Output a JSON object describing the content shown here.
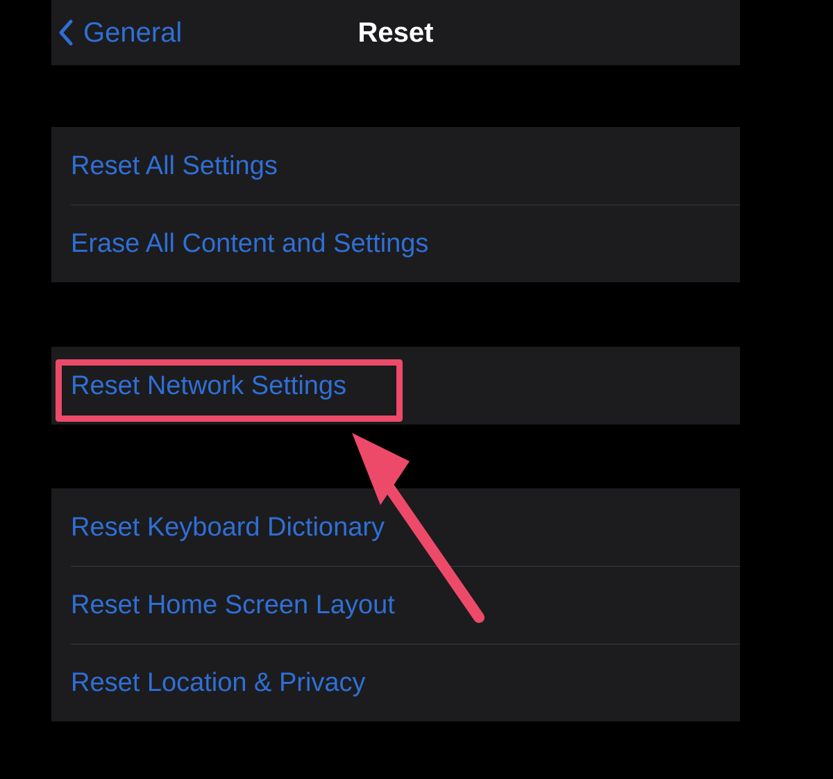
{
  "nav": {
    "back_label": "General",
    "title": "Reset"
  },
  "groups": {
    "g1": {
      "items": [
        {
          "label": "Reset All Settings"
        },
        {
          "label": "Erase All Content and Settings"
        }
      ]
    },
    "g2": {
      "items": [
        {
          "label": "Reset Network Settings"
        }
      ]
    },
    "g3": {
      "items": [
        {
          "label": "Reset Keyboard Dictionary"
        },
        {
          "label": "Reset Home Screen Layout"
        },
        {
          "label": "Reset Location & Privacy"
        }
      ]
    }
  },
  "annotation": {
    "highlight_color": "#ed4a6a"
  }
}
